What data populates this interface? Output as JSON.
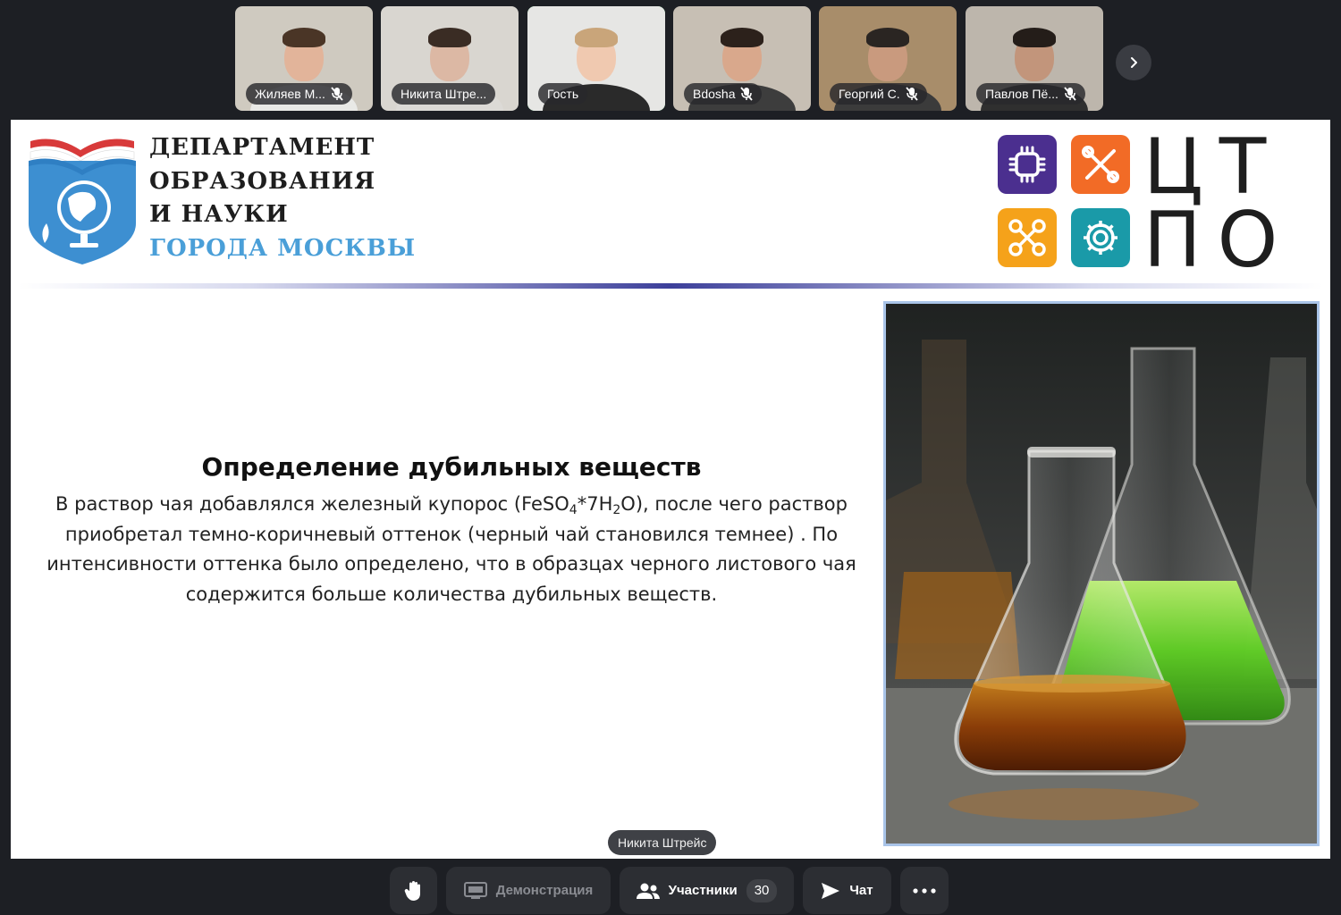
{
  "participants": [
    {
      "name": "Жиляев М...",
      "muted": true,
      "active": false,
      "bg": "#cfcac0",
      "skin": "#e2b49a",
      "hair": "#4a3526",
      "shirt": "#e9e9e6"
    },
    {
      "name": "Никита Штре...",
      "muted": false,
      "active": false,
      "bg": "#d9d6d0",
      "skin": "#dcb8a4",
      "hair": "#3a2c24",
      "shirt": "#dcdad6"
    },
    {
      "name": "Гость",
      "muted": false,
      "active": true,
      "bg": "#e6e6e4",
      "skin": "#f0c9b0",
      "hair": "#c9a57a",
      "shirt": "#2a2a2a"
    },
    {
      "name": "Bdosha",
      "muted": true,
      "active": false,
      "bg": "#c7bfb4",
      "skin": "#d9a88c",
      "hair": "#2c211b",
      "shirt": "#3d3d3d"
    },
    {
      "name": "Георгий С.",
      "muted": true,
      "active": false,
      "bg": "#a88d6a",
      "skin": "#c99a7e",
      "hair": "#2a2522",
      "shirt": "#3b3b3b"
    },
    {
      "name": "Павлов Пё...",
      "muted": true,
      "active": false,
      "bg": "#bdb6ac",
      "skin": "#c2957b",
      "hair": "#241d19",
      "shirt": "#2f2f2f"
    }
  ],
  "slide": {
    "dept_lines": [
      "ДЕПАРТАМЕНТ",
      "ОБРАЗОВАНИЯ",
      "И НАУКИ"
    ],
    "dept_city": "ГОРОДА МОСКВЫ",
    "ctpo_row1": "ЦТ",
    "ctpo_row2": "ПО",
    "ctpo_colors": [
      "#4b2f8f",
      "#f26b26",
      "#f5a21a",
      "#1a9aa8"
    ],
    "title": "Определение дубильных веществ",
    "body_part1": "В раствор чая добавлялся железный купорос (FeSO",
    "body_sub1": "4",
    "body_part2": "*7H",
    "body_sub2": "2",
    "body_part3": "O), после чего раствор приобретал темно-коричневый оттенок (черный чай становился темнее) . По интенсивности оттенка было определено, что в образцах черного листового чая содержится больше количества дубильных веществ."
  },
  "speaker_label": "Никита Штрейс",
  "toolbar": {
    "raise_hand_icon": "hand-icon",
    "screen_share_label": "Демонстрация",
    "participants_label": "Участники",
    "participants_count": "30",
    "chat_label": "Чат",
    "more_icon": "more-dots-icon"
  }
}
